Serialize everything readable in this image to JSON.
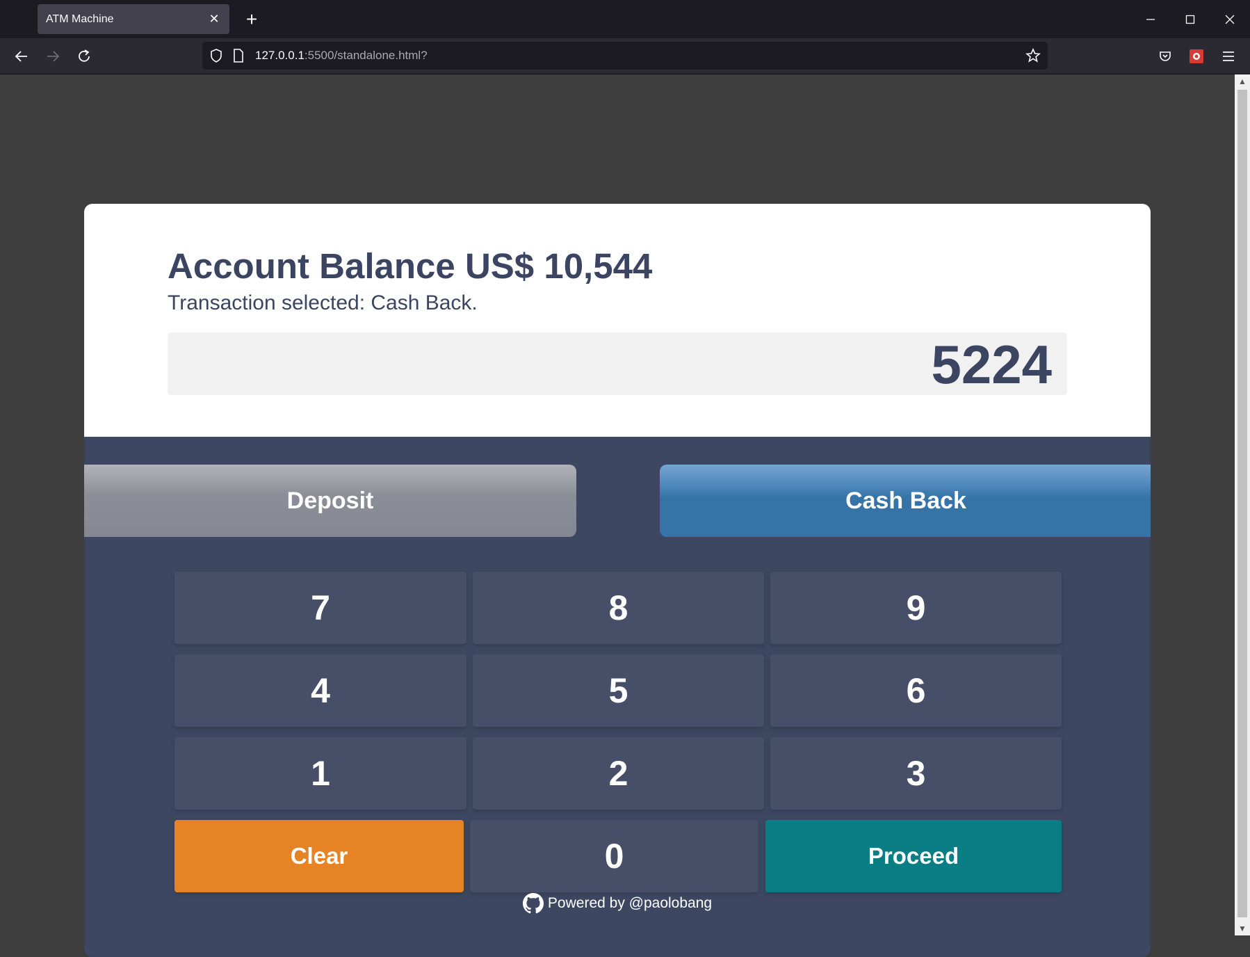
{
  "browser": {
    "tab_title": "ATM Machine",
    "url_host": "127.0.0.1",
    "url_rest": ":5500/standalone.html?"
  },
  "atm": {
    "balance_text": "Account Balance US$ 10,544",
    "transaction_text": "Transaction selected: Cash Back.",
    "amount": "5224",
    "modes": {
      "deposit": "Deposit",
      "cash_back": "Cash Back",
      "selected": "cash_back"
    },
    "keypad": {
      "k7": "7",
      "k8": "8",
      "k9": "9",
      "k4": "4",
      "k5": "5",
      "k6": "6",
      "k1": "1",
      "k2": "2",
      "k3": "3",
      "clear": "Clear",
      "k0": "0",
      "proceed": "Proceed"
    }
  },
  "footer": {
    "text": "Powered by @paolobang"
  },
  "colors": {
    "panel": "#3d4761",
    "key": "#464f67",
    "clear": "#e68425",
    "proceed": "#0b7e85",
    "cash_back": "#3674a8",
    "deposit": "#858893",
    "text_dark": "#3b4460"
  }
}
